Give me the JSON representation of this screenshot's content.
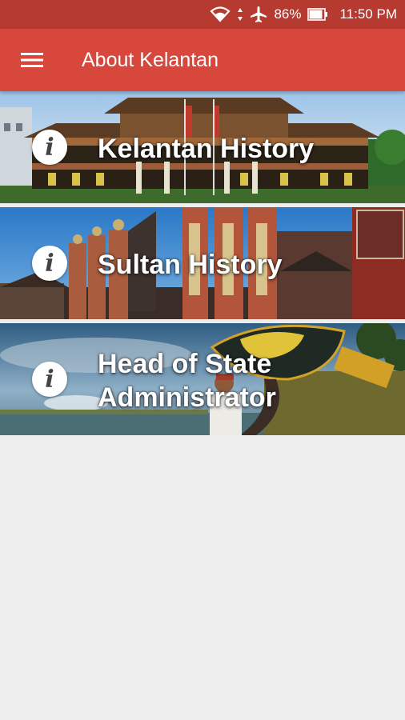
{
  "status_bar": {
    "battery": "86%",
    "time": "11:50 PM"
  },
  "app_bar": {
    "title": "About Kelantan",
    "menu_icon": "hamburger-menu-icon"
  },
  "cards": [
    {
      "label_line1": "Kelantan History",
      "label_line2": "",
      "icon": "info-icon"
    },
    {
      "label_line1": "Sultan History",
      "label_line2": "",
      "icon": "info-icon"
    },
    {
      "label_line1": "Head of State",
      "label_line2": "Administrator",
      "icon": "info-icon"
    }
  ],
  "colors": {
    "status_bar": "#b73a31",
    "app_bar": "#d7473b",
    "background": "#eeeeee"
  }
}
